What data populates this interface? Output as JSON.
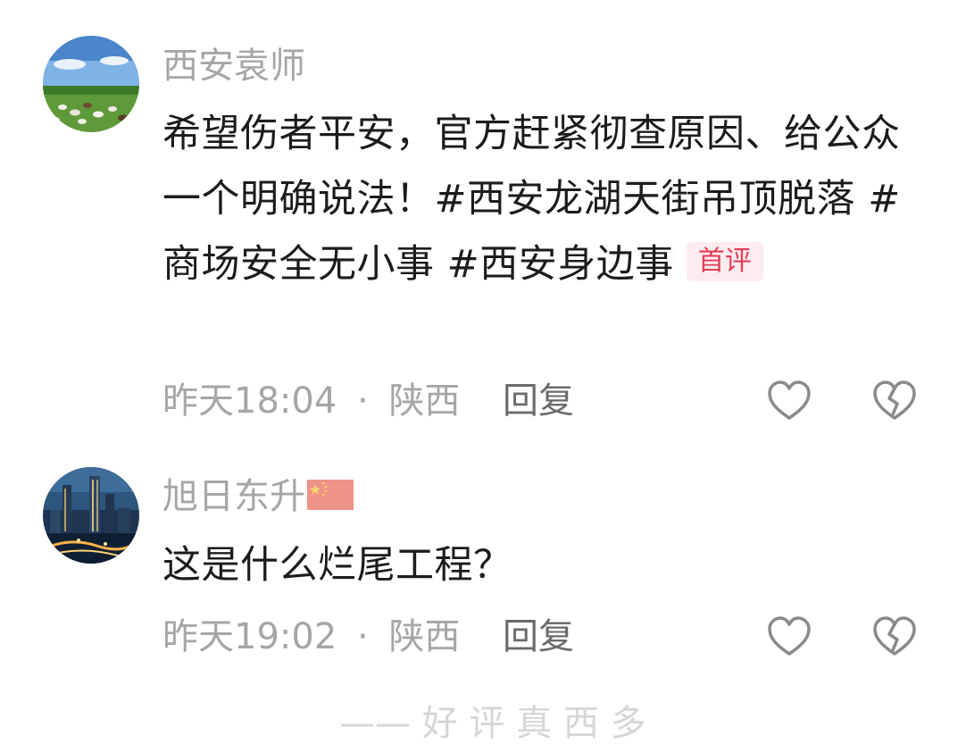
{
  "comments": [
    {
      "username": "西安袁师",
      "content": "希望伤者平安，官方赶紧彻查原因、给公众一个明确说法！#西安龙湖天街吊顶脱落 #商场安全无小事 #西安身边事",
      "badge": "首评",
      "time": "昨天18:04",
      "separator": "·",
      "location": "陕西",
      "reply_label": "回复",
      "avatar_icon": "landscape-sheep-avatar",
      "like_icon": "heart-outline-icon",
      "dislike_icon": "broken-heart-icon"
    },
    {
      "username": "旭日东升",
      "flag_icon": "china-flag-icon",
      "content": "这是什么烂尾工程？",
      "time": "昨天19:02",
      "separator": "·",
      "location": "陕西",
      "reply_label": "回复",
      "avatar_icon": "city-night-avatar",
      "like_icon": "heart-outline-icon",
      "dislike_icon": "broken-heart-icon"
    }
  ],
  "bottom_hint": "—— 好 评 真 西 多",
  "colors": {
    "username": "#a6a6a6",
    "content": "#1c1c1c",
    "meta": "#a6a6a6",
    "reply": "#6b6b6b",
    "badge_text": "#e23c55",
    "badge_bg": "#fdecef",
    "icon_stroke": "#8a8a8a"
  }
}
